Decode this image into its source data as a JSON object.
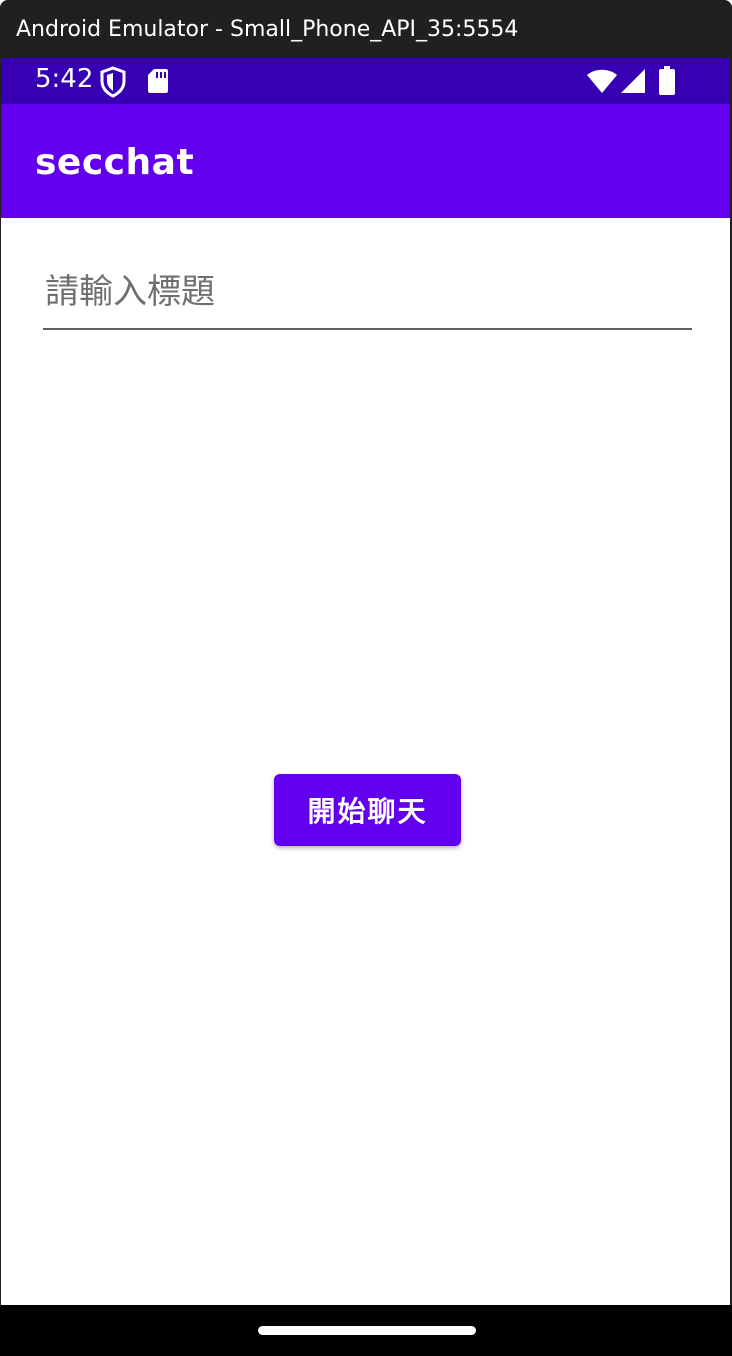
{
  "window": {
    "title": "Android Emulator - Small_Phone_API_35:5554"
  },
  "status_bar": {
    "time": "5:42",
    "icons": [
      "shield-icon",
      "sd-card-icon",
      "wifi-icon",
      "cell-signal-icon",
      "battery-icon"
    ]
  },
  "app_bar": {
    "title": "secchat"
  },
  "form": {
    "title_placeholder": "請輸入標題",
    "title_value": "",
    "start_button_label": "開始聊天"
  },
  "colors": {
    "status_bar": "#3700b3",
    "primary": "#6200ee",
    "background": "#ffffff",
    "window_frame": "#202020"
  }
}
